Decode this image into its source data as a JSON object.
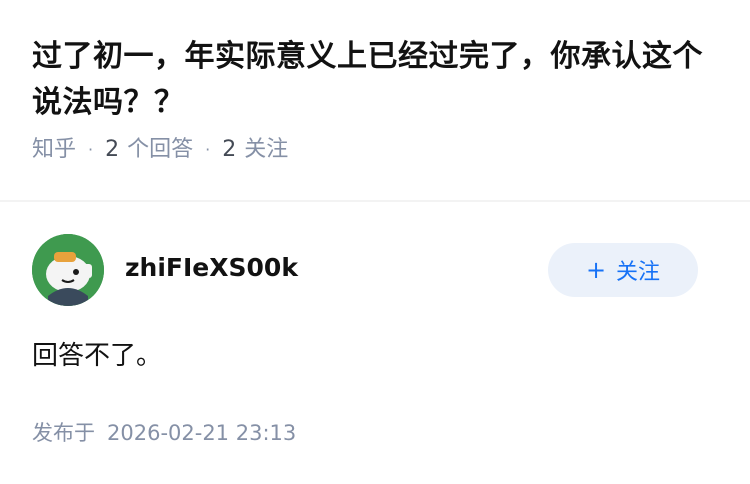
{
  "question": {
    "title": "过了初一，年实际意义上已经过完了，你承认这个说法吗？？",
    "source": "知乎",
    "answer_count": "2",
    "answer_label": "个回答",
    "follower_count": "2",
    "follower_label": "关注"
  },
  "answer": {
    "author_name": "zhiFIeXS00k",
    "follow_button": "关注",
    "follow_icon": "plus-icon",
    "content": "回答不了。",
    "published_label": "发布于",
    "published_time": "2026-02-21 23:13"
  },
  "colors": {
    "accent": "#1772f6",
    "follow_bg": "#ebf1fa",
    "meta": "#8590a6",
    "avatar_bg": "#3f9a4f"
  }
}
